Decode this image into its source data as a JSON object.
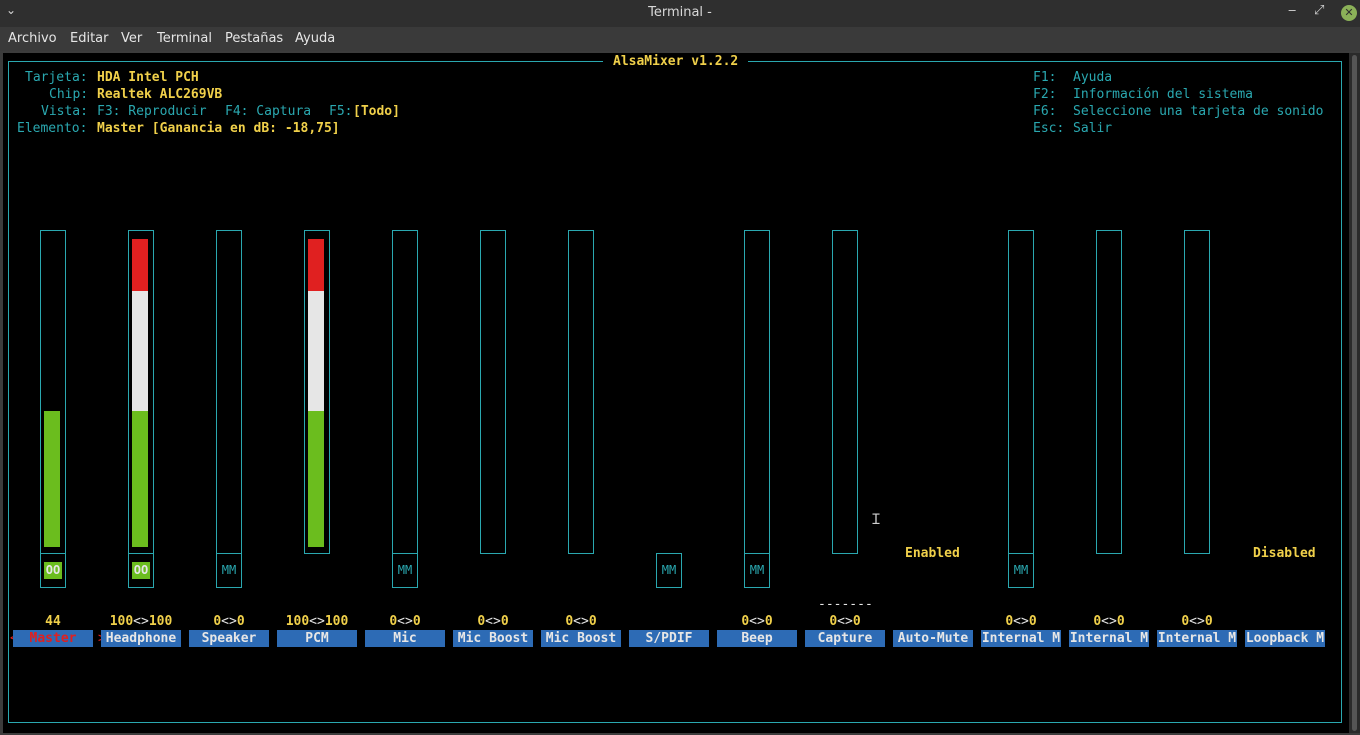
{
  "window": {
    "title": "Terminal -",
    "menu": [
      "Archivo",
      "Editar",
      "Ver",
      "Terminal",
      "Pestañas",
      "Ayuda"
    ]
  },
  "alsamixer": {
    "app_title": "AlsaMixer v1.2.2",
    "info": {
      "card_label": "Tarjeta:",
      "card_value": "HDA Intel PCH",
      "chip_label": "Chip:",
      "chip_value": "Realtek ALC269VB",
      "view_label": "Vista:",
      "view_play": "F3: Reproducir",
      "view_capture": "F4: Captura",
      "view_all_key": "F5:",
      "view_all_value": "[Todo]",
      "element_label": "Elemento:",
      "element_value": "Master [Ganancia en dB: -18,75]"
    },
    "help": {
      "f1_key": "F1:",
      "f1_text": "Ayuda",
      "f2_key": "F2:",
      "f2_text": "Información del sistema",
      "f6_key": "F6:",
      "f6_text": "Seleccione una tarjeta de sonido",
      "esc_key": "Esc:",
      "esc_text": "Salir"
    },
    "capture_marker": "-------",
    "channels": [
      {
        "name": "Master",
        "selected": true,
        "level": 44,
        "vol_left": "44",
        "vol_sep": "",
        "vol_right": "",
        "mute": "OO",
        "mute_on": true,
        "has_bar": true
      },
      {
        "name": "Headphone",
        "selected": false,
        "level": 100,
        "vol_left": "100",
        "vol_sep": "<>",
        "vol_right": "100",
        "mute": "OO",
        "mute_on": true,
        "has_bar": true
      },
      {
        "name": "Speaker",
        "selected": false,
        "level": 0,
        "vol_left": "0",
        "vol_sep": "<>",
        "vol_right": "0",
        "mute": "MM",
        "mute_on": false,
        "has_bar": true
      },
      {
        "name": "PCM",
        "selected": false,
        "level": 100,
        "vol_left": "100",
        "vol_sep": "<>",
        "vol_right": "100",
        "mute": "",
        "mute_on": false,
        "has_bar": true
      },
      {
        "name": "Mic",
        "selected": false,
        "level": 0,
        "vol_left": "0",
        "vol_sep": "<>",
        "vol_right": "0",
        "mute": "MM",
        "mute_on": false,
        "has_bar": true
      },
      {
        "name": "Mic Boost",
        "selected": false,
        "level": 0,
        "vol_left": "0",
        "vol_sep": "<>",
        "vol_right": "0",
        "mute": "",
        "mute_on": false,
        "has_bar": true
      },
      {
        "name": "Mic Boost",
        "selected": false,
        "level": 0,
        "vol_left": "0",
        "vol_sep": "<>",
        "vol_right": "0",
        "mute": "",
        "mute_on": false,
        "has_bar": true
      },
      {
        "name": "S/PDIF",
        "selected": false,
        "level": 0,
        "vol_left": "",
        "vol_sep": "",
        "vol_right": "",
        "mute": "MM",
        "mute_on": false,
        "has_bar": false
      },
      {
        "name": "Beep",
        "selected": false,
        "level": 0,
        "vol_left": "0",
        "vol_sep": "<>",
        "vol_right": "0",
        "mute": "MM",
        "mute_on": false,
        "has_bar": true
      },
      {
        "name": "Capture",
        "selected": false,
        "level": 0,
        "vol_left": "0",
        "vol_sep": "<>",
        "vol_right": "0",
        "mute": "",
        "mute_on": false,
        "has_bar": true
      },
      {
        "name": "Auto-Mute",
        "selected": false,
        "level": 0,
        "vol_left": "",
        "vol_sep": "",
        "vol_right": "",
        "mute": "",
        "mute_on": false,
        "has_bar": false,
        "switch_text": "Enabled"
      },
      {
        "name": "Internal M",
        "selected": false,
        "level": 0,
        "vol_left": "0",
        "vol_sep": "<>",
        "vol_right": "0",
        "mute": "MM",
        "mute_on": false,
        "has_bar": true
      },
      {
        "name": "Internal M",
        "selected": false,
        "level": 0,
        "vol_left": "0",
        "vol_sep": "<>",
        "vol_right": "0",
        "mute": "",
        "mute_on": false,
        "has_bar": true
      },
      {
        "name": "Internal M",
        "selected": false,
        "level": 0,
        "vol_left": "0",
        "vol_sep": "<>",
        "vol_right": "0",
        "mute": "",
        "mute_on": false,
        "has_bar": true
      },
      {
        "name": "Loopback M",
        "selected": false,
        "level": 0,
        "vol_left": "",
        "vol_sep": "",
        "vol_right": "",
        "mute": "",
        "mute_on": false,
        "has_bar": false,
        "switch_text": "Disabled"
      }
    ],
    "colors": {
      "bar_low": "#6bbd1e",
      "bar_mid": "#e6e6e6",
      "bar_high": "#e02020",
      "label_bg": "#2d6bb5",
      "frame": "#2aa8b0"
    }
  }
}
